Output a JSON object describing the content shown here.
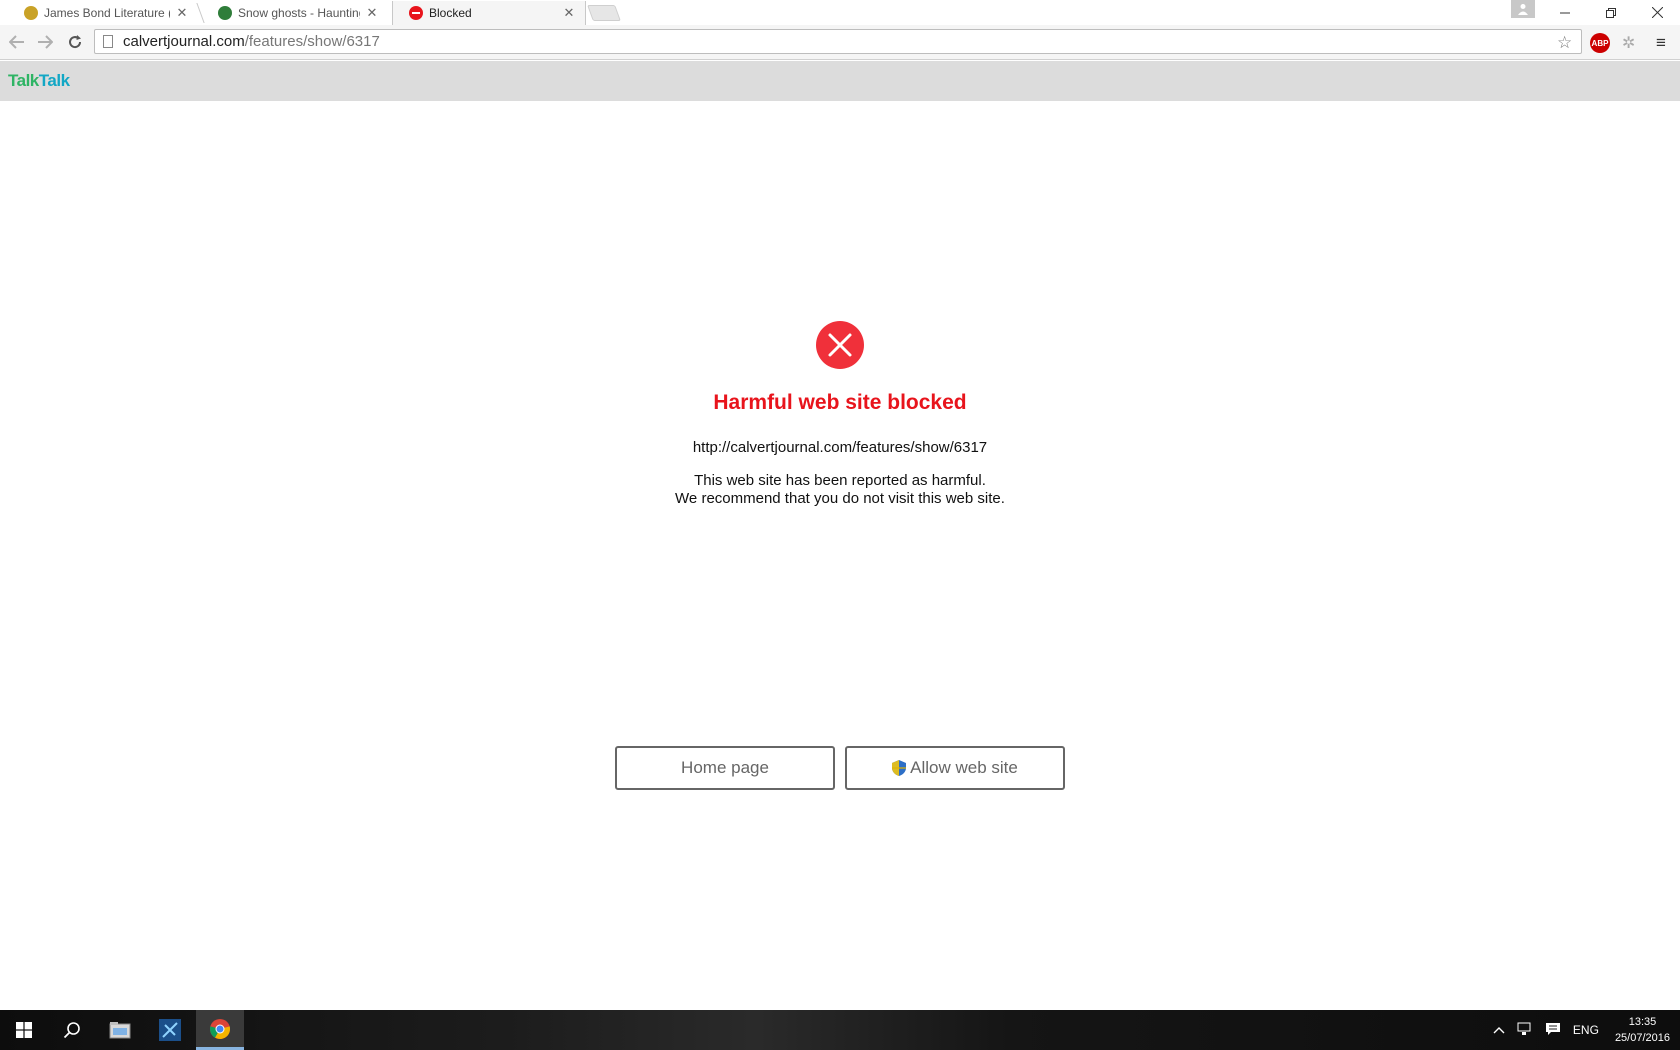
{
  "tabs": [
    {
      "title": "James Bond Literature (Pa",
      "favicon_color": "#c9a227"
    },
    {
      "title": "Snow ghosts - Haunting i",
      "favicon_color": "#2f7d3a"
    },
    {
      "title": "Blocked",
      "favicon_color": "#e8141c"
    }
  ],
  "toolbar": {
    "url_domain": "calvertjournal.com",
    "url_path": "/features/show/6317",
    "abp_label": "ABP"
  },
  "brand": {
    "part1": "Talk",
    "part2": "Talk",
    "color1": "#2eb464",
    "color2": "#12a7c5"
  },
  "block_page": {
    "heading": "Harmful web site blocked",
    "url": "http://calvertjournal.com/features/show/6317",
    "message_line1": "This web site has been reported as harmful.",
    "message_line2": "We recommend that you do not visit this web site.",
    "home_button": "Home page",
    "allow_button": "Allow web site",
    "accent_color": "#e8141c"
  },
  "taskbar": {
    "language": "ENG",
    "time": "13:35",
    "date": "25/07/2016"
  }
}
